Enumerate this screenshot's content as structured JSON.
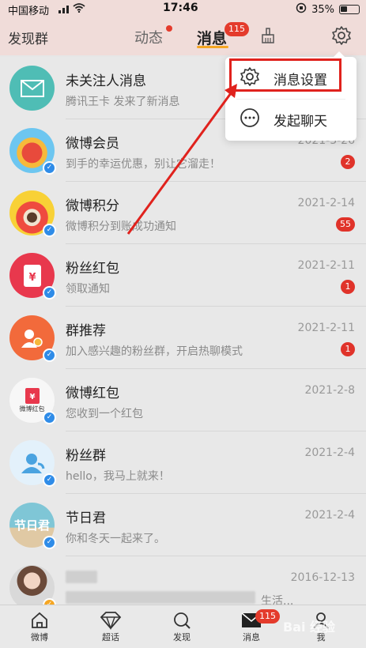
{
  "status": {
    "carrier": "中国移动",
    "time": "17:46",
    "battery": "35%"
  },
  "header": {
    "left_title": "发现群",
    "tabs": [
      {
        "label": "动态"
      },
      {
        "label": "消息"
      }
    ],
    "messages_badge": "115"
  },
  "dropdown": {
    "items": [
      {
        "label": "消息设置",
        "icon": "gear-icon"
      },
      {
        "label": "发起聊天",
        "icon": "chat-bubble-icon"
      }
    ]
  },
  "rows": [
    {
      "name": "未关注人消息",
      "msg": "腾讯王卡 发来了新消息",
      "date": "",
      "count": ""
    },
    {
      "name": "微博会员",
      "msg": "到手的幸运优惠，别让它溜走！",
      "date": "2021-3-26",
      "count": "2"
    },
    {
      "name": "微博积分",
      "msg": "微博积分到账成功通知",
      "date": "2021-2-14",
      "count": "55"
    },
    {
      "name": "粉丝红包",
      "msg": "领取通知",
      "date": "2021-2-11",
      "count": "1"
    },
    {
      "name": "群推荐",
      "msg": "加入感兴趣的粉丝群，开启热聊模式",
      "date": "2021-2-11",
      "count": "1"
    },
    {
      "name": "微博红包",
      "msg": "您收到一个红包",
      "date": "2021-2-8",
      "count": "",
      "avatar_text": "微博红包"
    },
    {
      "name": "粉丝群",
      "msg": "hello，我马上就来！",
      "date": "2021-2-4",
      "count": ""
    },
    {
      "name": "节日君",
      "msg": "你和冬天一起来了。",
      "date": "2021-2-4",
      "count": "",
      "avatar_text": "节日君"
    },
    {
      "name": "",
      "msg": "生活...",
      "date": "2016-12-13",
      "count": ""
    }
  ],
  "bottom_nav": [
    {
      "label": "微博",
      "icon": "home-icon"
    },
    {
      "label": "超话",
      "icon": "diamond-icon"
    },
    {
      "label": "发现",
      "icon": "search-icon"
    },
    {
      "label": "消息",
      "icon": "mail-icon",
      "badge": "115"
    },
    {
      "label": "我",
      "icon": "person-icon"
    }
  ],
  "watermark": "Bai 经验"
}
